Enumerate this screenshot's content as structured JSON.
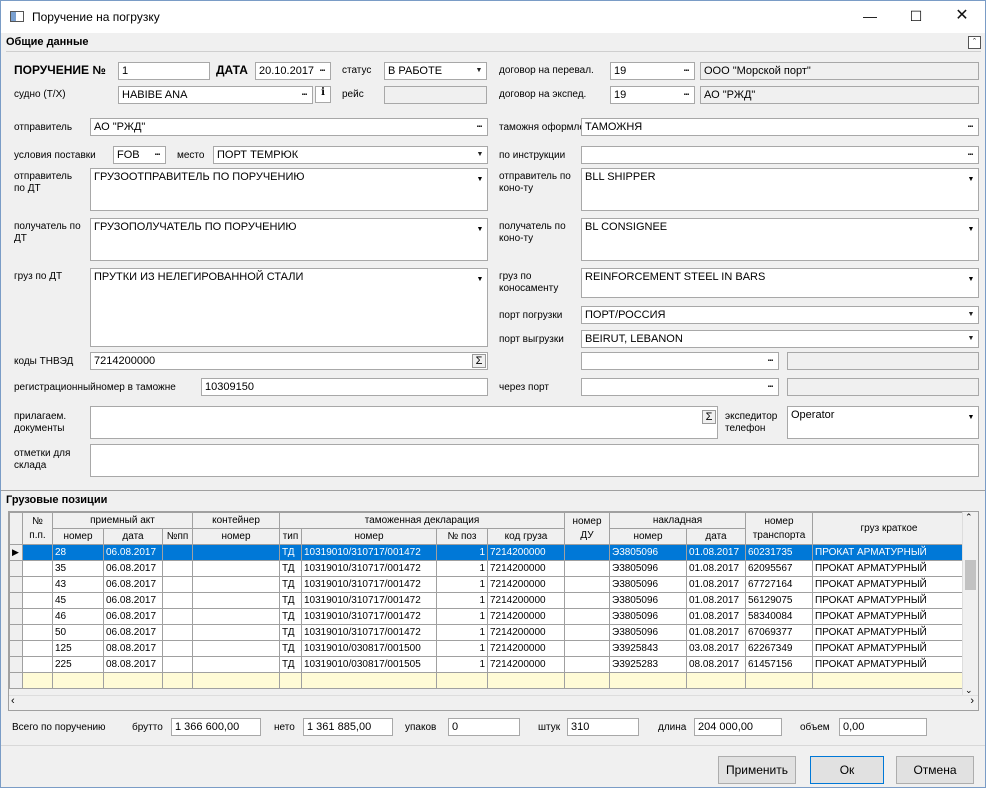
{
  "window": {
    "title": "Поручение на погрузку"
  },
  "general": {
    "section_title": "Общие данные",
    "order_label": "ПОРУЧЕНИЕ №",
    "order_no": "1",
    "date_label": "ДАТА",
    "date": "20.10.2017",
    "status_label": "статус",
    "status": "В РАБОТЕ",
    "carrier_contract_label": "договор на перевал.",
    "carrier_contract": "19",
    "carrier_name": "ООО \"Морской порт\"",
    "vessel_label": "судно (Т/Х)",
    "vessel": "HABIBE ANA",
    "voyage_label": "рейс",
    "voyage": "",
    "forwarding_contract_label": "договор на экспед.",
    "forwarding_contract": "19",
    "forwarding_name": "АО \"РЖД\"",
    "sender_label": "отправитель",
    "sender": "АО \"РЖД\"",
    "customs_label": "таможня оформлен.",
    "customs": "ТАМОЖНЯ",
    "delivery_label": "условия поставки",
    "delivery": "FOB",
    "place_label": "место",
    "place": "ПОРТ ТЕМРЮК",
    "instructions_label": "по инструкции",
    "instructions": "",
    "sender_dt_label": "отправитель по ДТ",
    "sender_dt": "ГРУЗООТПРАВИТЕЛЬ ПО ПОРУЧЕНИЮ",
    "sender_bl_label": "отправитель по коно-ту",
    "sender_bl": "BLL SHIPPER",
    "receiver_dt_label": "получатель по ДТ",
    "receiver_dt": "ГРУЗОПОЛУЧАТЕЛЬ ПО ПОРУЧЕНИЮ",
    "receiver_bl_label": "получатель по коно-ту",
    "receiver_bl": "BL CONSIGNEE",
    "cargo_dt_label": "груз по ДТ",
    "cargo_dt": "ПРУТКИ  ИЗ НЕЛЕГИРОВАННОЙ СТАЛИ",
    "cargo_bl_label": "груз по коносаменту",
    "cargo_bl": "REINFORCEMENT STEEL IN BARS",
    "port_load_label": "порт погрузки",
    "port_load": "ПОРТ/РОССИЯ",
    "port_unload_label": "порт выгрузки",
    "port_unload": "BEIRUT, LEBANON",
    "tnved_label": "коды ТНВЭД",
    "tnved": "7214200000",
    "regnum_label": "регистрационныйномер в таможне",
    "regnum": "10309150",
    "via_port_label": "через порт",
    "via_port": "",
    "docs_label": "прилагаем. документы",
    "docs": "",
    "forwarder_label": "экспедитор телефон",
    "forwarder": "Operator",
    "warehouse_label": "отметки для склада",
    "warehouse": ""
  },
  "cargo": {
    "section_title": "Грузовые позиции",
    "groups": {
      "accept": "приемный акт",
      "container": "контейнер",
      "customs": "таможенная декларация",
      "waybill": "накладная"
    },
    "headers": {
      "np": "№ п.п.",
      "acc_no": "номер",
      "acc_date": "дата",
      "npp": "№пп",
      "cont_no": "номер",
      "type": "тип",
      "decl_no": "номер",
      "pos": "№ поз",
      "code": "код груза",
      "du": "номер ДУ",
      "wb_no": "номер",
      "wb_date": "дата",
      "transport": "номер транспорта",
      "short": "груз краткое"
    },
    "rows": [
      {
        "acc_no": "28",
        "acc_date": "06.08.2017",
        "npp": "",
        "cont": "",
        "type": "ТД",
        "decl": "10319010/310717/001472",
        "pos": "1",
        "code": "7214200000",
        "du": "",
        "wb": "Э3805096",
        "wb_date": "01.08.2017",
        "tr": "60231735",
        "short": "ПРОКАТ АРМАТУРНЫЙ"
      },
      {
        "acc_no": "35",
        "acc_date": "06.08.2017",
        "npp": "",
        "cont": "",
        "type": "ТД",
        "decl": "10319010/310717/001472",
        "pos": "1",
        "code": "7214200000",
        "du": "",
        "wb": "Э3805096",
        "wb_date": "01.08.2017",
        "tr": "62095567",
        "short": "ПРОКАТ АРМАТУРНЫЙ"
      },
      {
        "acc_no": "43",
        "acc_date": "06.08.2017",
        "npp": "",
        "cont": "",
        "type": "ТД",
        "decl": "10319010/310717/001472",
        "pos": "1",
        "code": "7214200000",
        "du": "",
        "wb": "Э3805096",
        "wb_date": "01.08.2017",
        "tr": "67727164",
        "short": "ПРОКАТ АРМАТУРНЫЙ"
      },
      {
        "acc_no": "45",
        "acc_date": "06.08.2017",
        "npp": "",
        "cont": "",
        "type": "ТД",
        "decl": "10319010/310717/001472",
        "pos": "1",
        "code": "7214200000",
        "du": "",
        "wb": "Э3805096",
        "wb_date": "01.08.2017",
        "tr": "56129075",
        "short": "ПРОКАТ АРМАТУРНЫЙ"
      },
      {
        "acc_no": "46",
        "acc_date": "06.08.2017",
        "npp": "",
        "cont": "",
        "type": "ТД",
        "decl": "10319010/310717/001472",
        "pos": "1",
        "code": "7214200000",
        "du": "",
        "wb": "Э3805096",
        "wb_date": "01.08.2017",
        "tr": "58340084",
        "short": "ПРОКАТ АРМАТУРНЫЙ"
      },
      {
        "acc_no": "50",
        "acc_date": "06.08.2017",
        "npp": "",
        "cont": "",
        "type": "ТД",
        "decl": "10319010/310717/001472",
        "pos": "1",
        "code": "7214200000",
        "du": "",
        "wb": "Э3805096",
        "wb_date": "01.08.2017",
        "tr": "67069377",
        "short": "ПРОКАТ АРМАТУРНЫЙ"
      },
      {
        "acc_no": "125",
        "acc_date": "08.08.2017",
        "npp": "",
        "cont": "",
        "type": "ТД",
        "decl": "10319010/030817/001500",
        "pos": "1",
        "code": "7214200000",
        "du": "",
        "wb": "Э3925843",
        "wb_date": "03.08.2017",
        "tr": "62267349",
        "short": "ПРОКАТ АРМАТУРНЫЙ"
      },
      {
        "acc_no": "225",
        "acc_date": "08.08.2017",
        "npp": "",
        "cont": "",
        "type": "ТД",
        "decl": "10319010/030817/001505",
        "pos": "1",
        "code": "7214200000",
        "du": "",
        "wb": "Э3925283",
        "wb_date": "08.08.2017",
        "tr": "61457156",
        "short": "ПРОКАТ АРМАТУРНЫЙ"
      }
    ]
  },
  "totals": {
    "label": "Всего по поручению",
    "gross_label": "брутто",
    "gross": "1 366 600,00",
    "net_label": "нето",
    "net": "1 361 885,00",
    "pack_label": "упаков",
    "pack": "0",
    "pcs_label": "штук",
    "pcs": "310",
    "length_label": "длина",
    "length": "204 000,00",
    "volume_label": "объем",
    "volume": "0,00"
  },
  "buttons": {
    "apply": "Применить",
    "ok": "Ок",
    "cancel": "Отмена"
  }
}
